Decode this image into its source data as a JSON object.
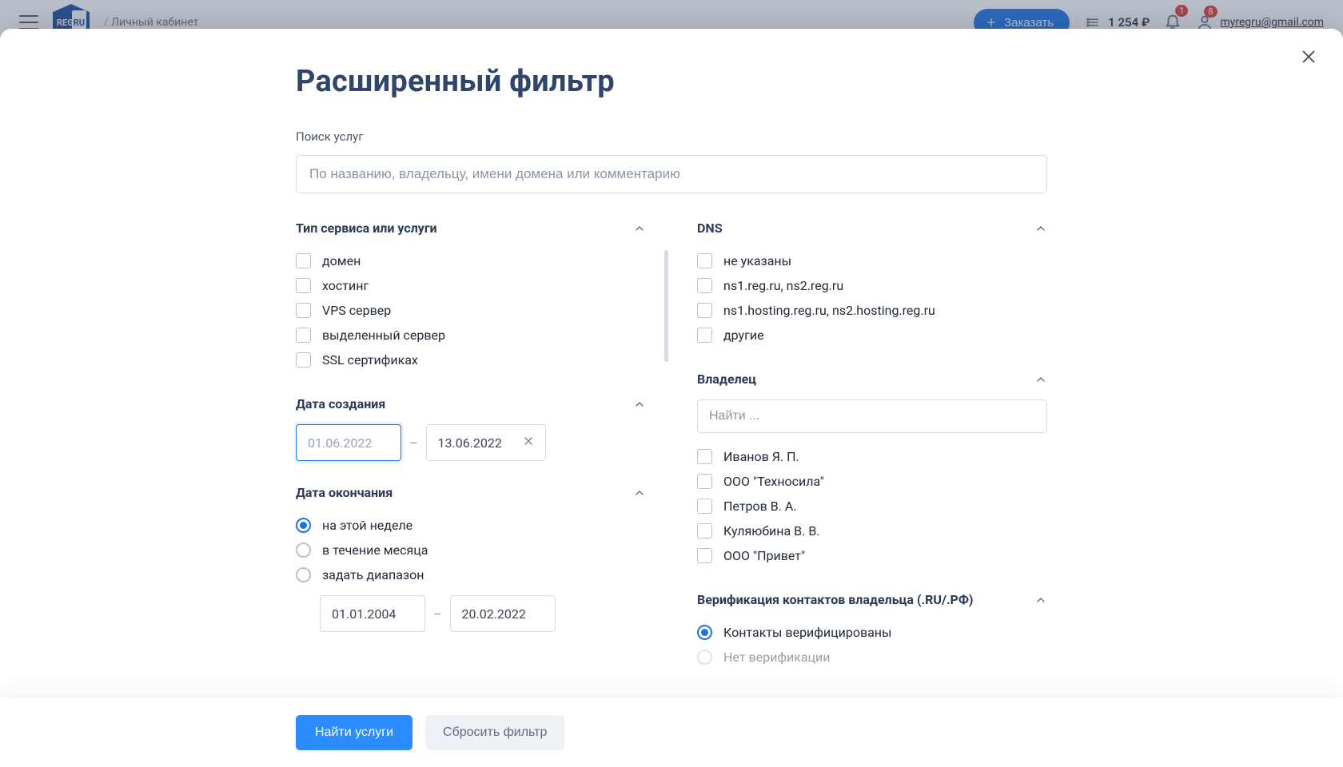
{
  "header": {
    "logo_reg": "REG",
    "logo_ru": "RU",
    "breadcrumb": "Личный кабинет",
    "order_button": "Заказать",
    "balance": "1 254 ₽",
    "bell_badge": "1",
    "user_badge": "8",
    "user_email": "myregru@gmail.com"
  },
  "modal": {
    "title": "Расширенный фильтр",
    "search": {
      "label": "Поиск услуг",
      "placeholder": "По названию, владельцу, имени домена или комментарию"
    },
    "service_type": {
      "title": "Тип сервиса или услуги",
      "items": [
        "домен",
        "хостинг",
        "VPS сервер",
        "выделенный сервер",
        "SSL сертификах"
      ]
    },
    "creation": {
      "title": "Дата создания",
      "from_placeholder": "01.06.2022",
      "to_value": "13.06.2022"
    },
    "expiry": {
      "title": "Дата окончания",
      "options": [
        "на этой неделе",
        "в течение месяца",
        "задать диапазон"
      ],
      "range_from": "01.01.2004",
      "range_to": "20.02.2022"
    },
    "dns": {
      "title": "DNS",
      "items": [
        "не указаны",
        "ns1.reg.ru, ns2.reg.ru",
        "ns1.hosting.reg.ru, ns2.hosting.reg.ru",
        "другие"
      ]
    },
    "owner": {
      "title": "Владелец",
      "search_placeholder": "Найти ...",
      "items": [
        "Иванов Я. П.",
        "ООО \"Техносила\"",
        "Петров В. А.",
        "Куляюбина В. В.",
        "ООО \"Привет\""
      ]
    },
    "verification": {
      "title": "Верификация контактов владельца (.RU/.РФ)",
      "options": [
        "Контакты верифицированы",
        "Нет верификации"
      ]
    },
    "footer": {
      "apply": "Найти услуги",
      "reset": "Сбросить фильтр"
    }
  }
}
